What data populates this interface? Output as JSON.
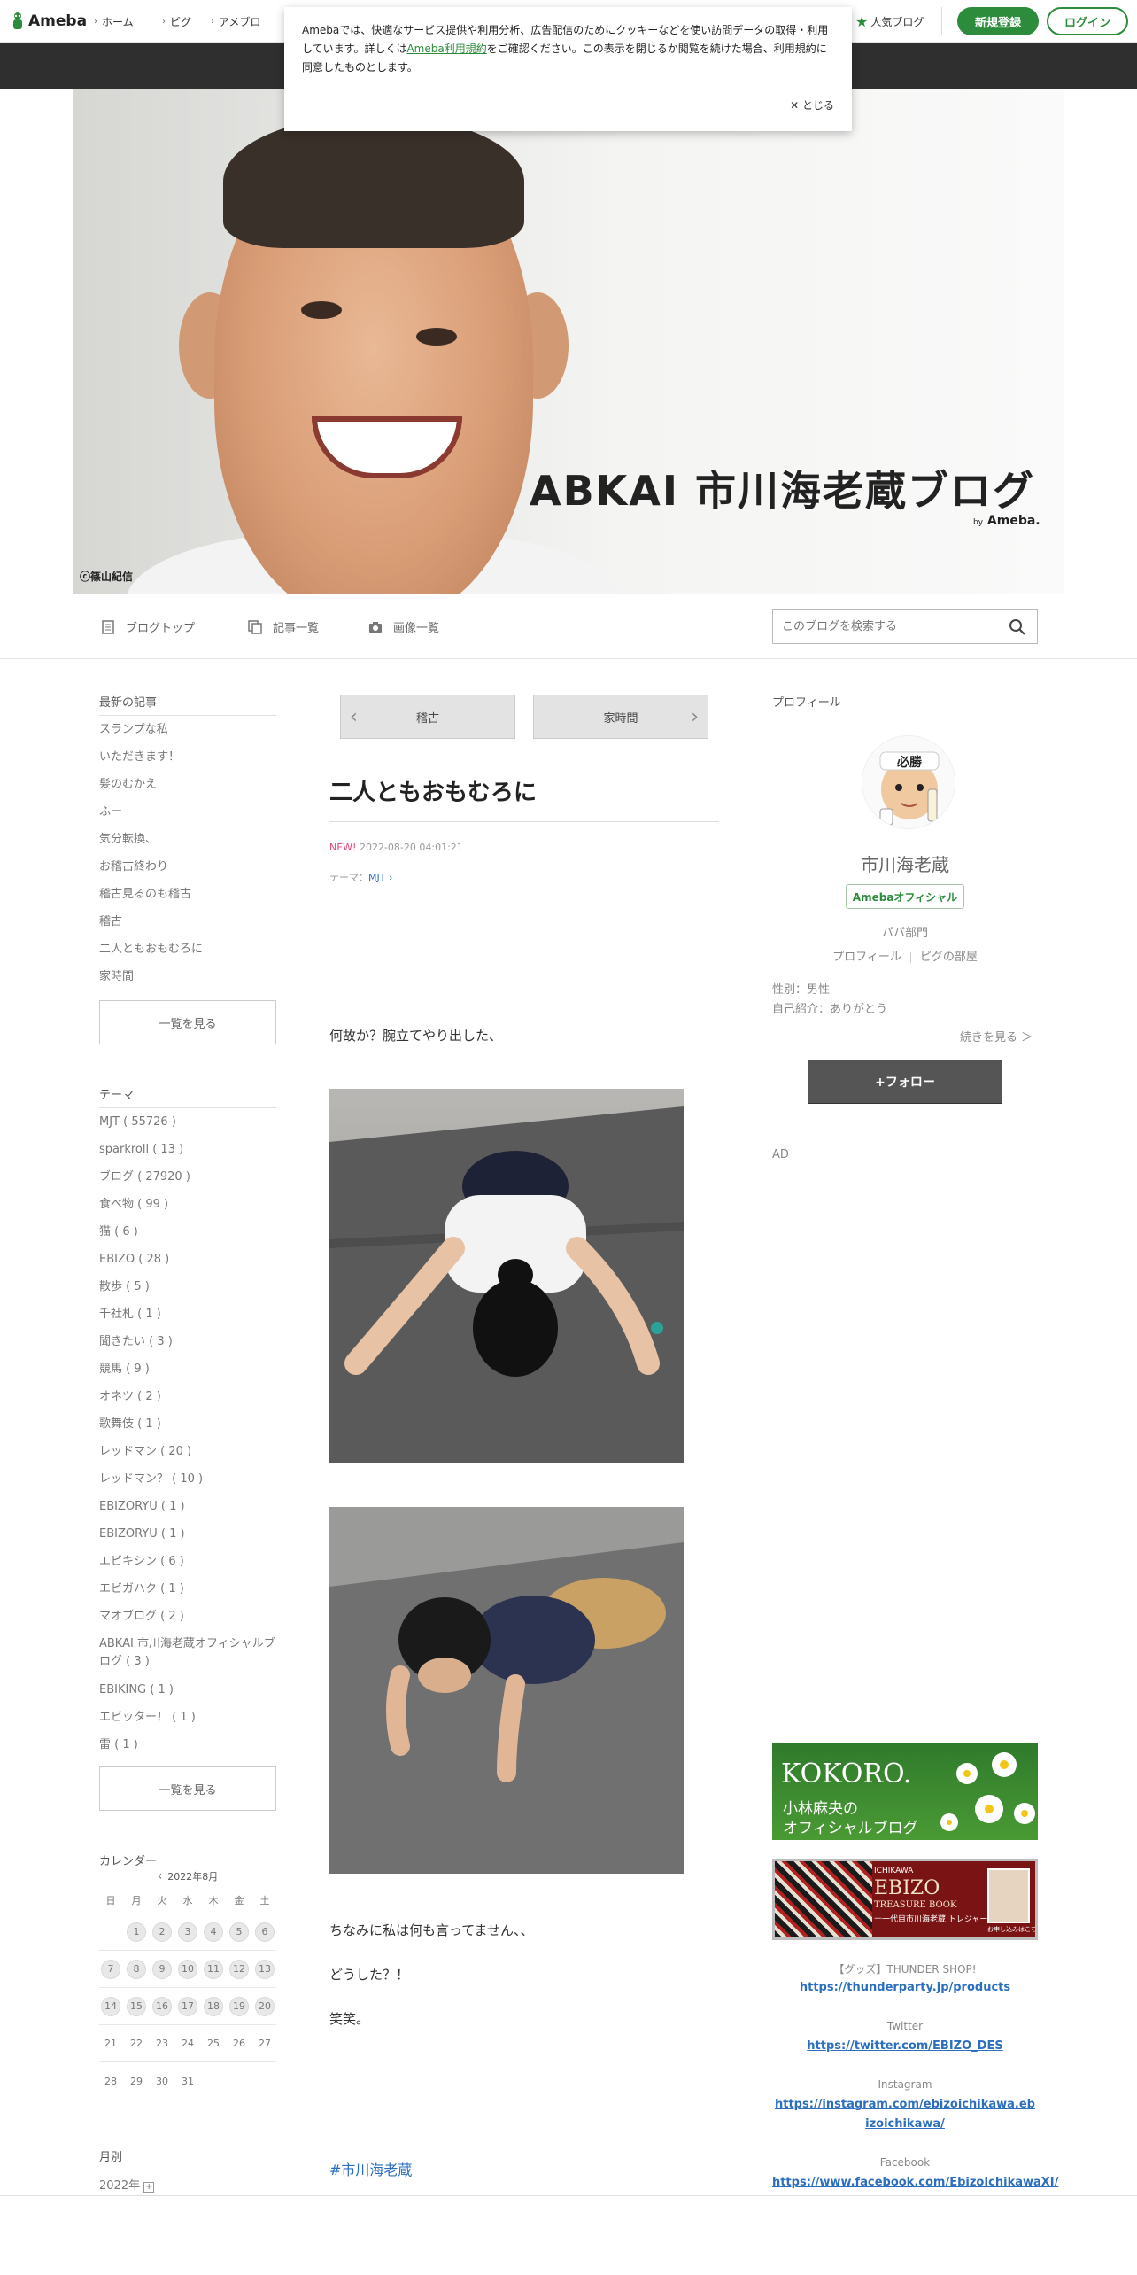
{
  "topbar": {
    "logo": "Ameba",
    "nav": [
      "ホーム",
      "ピグ",
      "アメブロ"
    ],
    "popular": "人気ブログ",
    "signup": "新規登録",
    "login": "ログイン"
  },
  "cookie": {
    "text1": "Amebaでは、快適なサービス提供や利用分析、広告配信のためにクッキーなどを使い訪問データの取得・利用しています。詳しくは",
    "link": "Ameba利用規約",
    "text2": "をご確認ください。この表示を閉じるか閲覧を続けた場合、利用規約に同意したものとします。",
    "close": "とじる"
  },
  "header": {
    "title": "ABKAI 市川海老蔵ブログ",
    "by": "by",
    "brand": "Ameba.",
    "credit": "ⓒ篠山紀信"
  },
  "blognav": {
    "top": "ブログトップ",
    "list": "記事一覧",
    "images": "画像一覧",
    "search_placeholder": "このブログを検索する"
  },
  "sidebar": {
    "recent_heading": "最新の記事",
    "recent": [
      "スランプな私",
      "いただきます！",
      "髪のむかえ",
      "ふー",
      "気分転換、",
      "お稽古終わり",
      "稽古見るのも稽古",
      "稽古",
      "二人ともおもむろに",
      "家時間"
    ],
    "see_all": "一覧を見る",
    "theme_heading": "テーマ",
    "themes": [
      "MJT ( 55726 )",
      "sparkroll ( 13 )",
      "ブログ ( 27920 )",
      "食べ物 ( 99 )",
      "猫 ( 6 )",
      "EBIZO ( 28 )",
      "散歩 ( 5 )",
      "千社札 ( 1 )",
      "聞きたい ( 3 )",
      "競馬 ( 9 )",
      "オネツ ( 2 )",
      "歌舞伎 ( 1 )",
      "レッドマン ( 20 )",
      "レッドマン？ ( 10 )",
      "EBIZORYU ( 1 )",
      "EBIZORYU ( 1 )",
      "エビキシン ( 6 )",
      "エビガハク ( 1 )",
      "マオブログ ( 2 )",
      "ABKAI 市川海老蔵オフィシャルブログ ( 3 )",
      "EBIKING ( 1 )",
      "エビッター！ ( 1 )",
      "雷 ( 1 )"
    ],
    "see_all2": "一覧を見る",
    "calendar_heading": "カレンダー",
    "calendar_month": "2022年8月",
    "weekdays": [
      "日",
      "月",
      "火",
      "水",
      "木",
      "金",
      "土"
    ],
    "weeks": [
      [
        "",
        "1",
        "2",
        "3",
        "4",
        "5",
        "6"
      ],
      [
        "7",
        "8",
        "9",
        "10",
        "11",
        "12",
        "13"
      ],
      [
        "14",
        "15",
        "16",
        "17",
        "18",
        "19",
        "20"
      ],
      [
        "21",
        "22",
        "23",
        "24",
        "25",
        "26",
        "27"
      ],
      [
        "28",
        "29",
        "30",
        "31",
        "",
        "",
        ""
      ]
    ],
    "monthly_heading": "月別",
    "monthly_year": "2022年"
  },
  "article": {
    "prev": "稽古",
    "next": "家時間",
    "title": "二人ともおもむろに",
    "new_badge": "NEW!",
    "date": "2022-08-20 04:01:21",
    "theme_label": "テーマ：",
    "theme": "MJT",
    "p1": "何故か？腕立てやり出した、",
    "p2": "ちなみに私は何も言ってません、、",
    "p3": "どうした？！",
    "p4": "笑笑。",
    "hashtag": "#市川海老蔵"
  },
  "profile": {
    "heading": "プロフィール",
    "avatar_text": "必勝",
    "name": "市川海老蔵",
    "official": "Amebaオフィシャル",
    "category": "パパ部門",
    "link_profile": "プロフィール",
    "link_pig": "ピグの部屋",
    "gender": "性別：男性",
    "intro": "自己紹介：ありがとう",
    "read_more": "続きを見る ＞",
    "follow": "+フォロー",
    "ad": "AD"
  },
  "banners": {
    "kokoro_title": "KOKORO.",
    "kokoro_sub1": "小林麻央の",
    "kokoro_sub2": "オフィシャルブログ",
    "ebizo_title": "EBIZO",
    "ebizo_sub": "TREASURE BOOK",
    "ebizo_brand": "ICHIKAWA",
    "ebizo_jp": "十一代目市川海老蔵 トレジャーブック",
    "ebizo_cta": "お申し込みはこちら"
  },
  "links": [
    {
      "label": "【グッズ】THUNDER SHOP!",
      "url": "https://thunderparty.jp/products"
    },
    {
      "label": "Twitter",
      "url": "https://twitter.com/EBIZO_DES"
    },
    {
      "label": "Instagram",
      "url": "https://instagram.com/ebizoichikawa.ebizoichikawa/"
    },
    {
      "label": "Facebook",
      "url": "https://www.facebook.com/EbizoIchikawaXI/"
    }
  ]
}
